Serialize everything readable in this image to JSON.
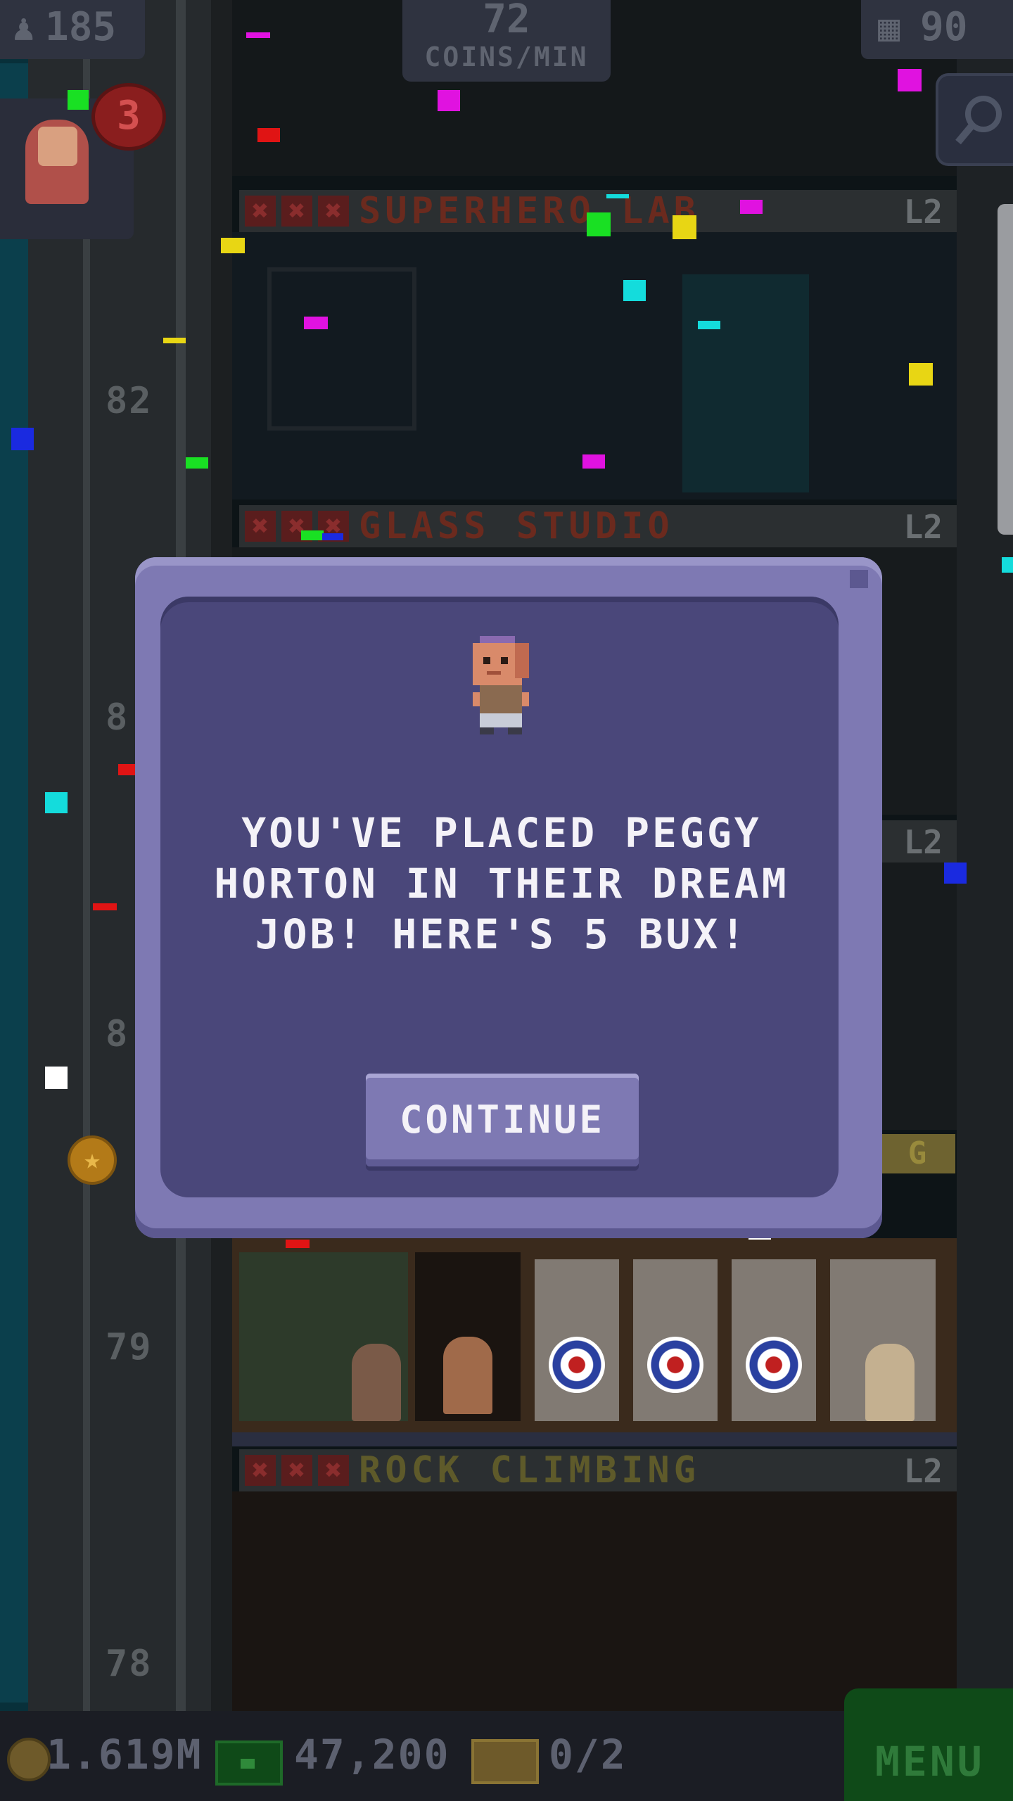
{
  "hud": {
    "population": "185",
    "coins_rate_value": "72",
    "coins_rate_unit": "COINS/MIN",
    "floors": "90",
    "notification_count": "3"
  },
  "floors": [
    {
      "name": "SUPERHERO LAB",
      "level": "L2"
    },
    {
      "name": "GLASS STUDIO",
      "level": "L2"
    },
    {
      "name": "",
      "level": "L2"
    },
    {
      "name": "ROCK CLIMBING",
      "level": "L2"
    }
  ],
  "floor_numbers": [
    "82",
    "8",
    "8",
    "79",
    "78"
  ],
  "gold_tag": "G",
  "dialog": {
    "message": "YOU'VE PLACED PEGGY HORTON IN THEIR DREAM JOB! HERE'S 5 BUX!",
    "continue_label": "CONTINUE"
  },
  "bottom_bar": {
    "coins": "1.619M",
    "bux": "47,200",
    "tickets": "0/2",
    "menu_label": "MENU"
  },
  "colors": {
    "dialog_frame": "#7e79b3",
    "dialog_body": "#4a477a",
    "menu_green": "#0f4a18"
  },
  "icons": [
    "person-icon",
    "building-icon",
    "search-icon",
    "coin-icon",
    "bux-icon",
    "ticket-icon",
    "bitizen-avatar-icon"
  ]
}
